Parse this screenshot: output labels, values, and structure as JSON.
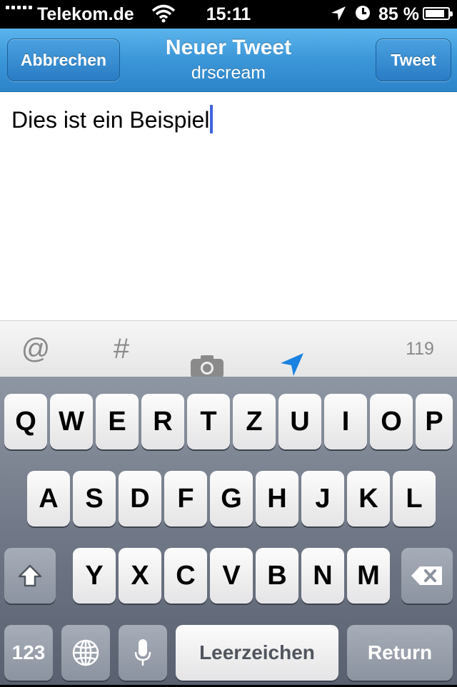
{
  "status_bar": {
    "carrier": "Telekom.de",
    "time": "15:11",
    "battery_percent": "85 %",
    "battery_level": 0.85,
    "signal_bars": 5,
    "icons": [
      "signal-icon",
      "wifi-icon",
      "location-icon",
      "clock-icon",
      "battery-icon"
    ]
  },
  "navbar": {
    "cancel_label": "Abbrechen",
    "title": "Neuer Tweet",
    "subtitle": "drscream",
    "tweet_label": "Tweet"
  },
  "compose": {
    "text": "Dies ist ein Beispiel"
  },
  "accessory": {
    "mention": "@",
    "hashtag": "#",
    "camera_icon": "camera-icon",
    "location_icon": "location-arrow-icon",
    "char_count": "119",
    "location_color": "#1a82e0"
  },
  "keyboard": {
    "row1": [
      "Q",
      "W",
      "E",
      "R",
      "T",
      "Z",
      "U",
      "I",
      "O",
      "P"
    ],
    "row2": [
      "A",
      "S",
      "D",
      "F",
      "G",
      "H",
      "J",
      "K",
      "L"
    ],
    "row3": [
      "Y",
      "X",
      "C",
      "V",
      "B",
      "N",
      "M"
    ],
    "numbers_key": "123",
    "space_key": "Leerzeichen",
    "return_key": "Return",
    "icons": [
      "shift-icon",
      "delete-icon",
      "globe-icon",
      "microphone-icon"
    ]
  }
}
